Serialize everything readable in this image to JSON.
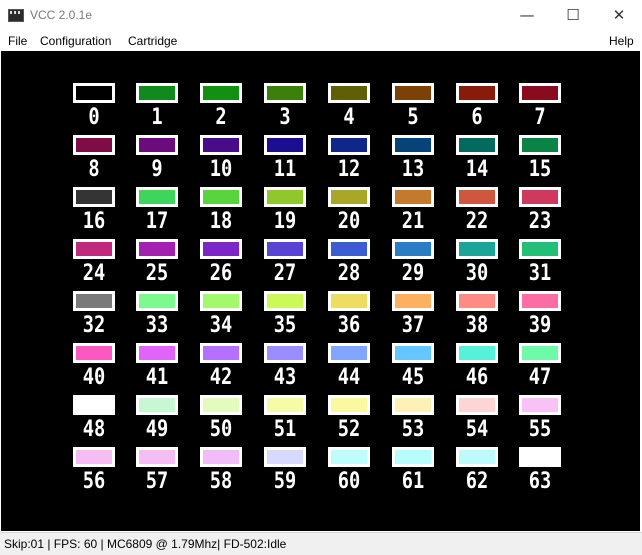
{
  "window": {
    "title": "VCC 2.0.1e",
    "minimize_glyph": "—",
    "maximize_glyph": "☐",
    "close_glyph": "✕"
  },
  "menu": {
    "file": "File",
    "configuration": "Configuration",
    "cartridge": "Cartridge",
    "help": "Help"
  },
  "palette": {
    "colors": [
      "#000000",
      "#12891c",
      "#139012",
      "#3c7f0a",
      "#5f6005",
      "#7d4006",
      "#891b0a",
      "#880b1e",
      "#7e0c45",
      "#6b0c7c",
      "#490c88",
      "#1b0e90",
      "#0d2889",
      "#074377",
      "#06695f",
      "#0a8344",
      "#343434",
      "#3fd45c",
      "#58d53d",
      "#8ec82c",
      "#aaa628",
      "#c47a2c",
      "#d0573f",
      "#d0395e",
      "#c0297c",
      "#a420b0",
      "#7c26c8",
      "#5744d4",
      "#3a5dd4",
      "#2a7cc4",
      "#1aa598",
      "#22c077",
      "#7a7a7a",
      "#7dfa8d",
      "#a3f86b",
      "#cbf957",
      "#eedd60",
      "#fdb060",
      "#fe8c84",
      "#fd6ca2",
      "#fd57c4",
      "#df64f7",
      "#b66ffe",
      "#9c8dfe",
      "#81a6fd",
      "#66c7fe",
      "#56f1d9",
      "#6efba8",
      "#ffffff",
      "#c7f8d3",
      "#e3fbbc",
      "#f6fba6",
      "#fcf8a2",
      "#fdf1b6",
      "#fdd5d2",
      "#f8c2f6",
      "#f6bcf3",
      "#f6bdf5",
      "#f2bcf9",
      "#d8d9fe",
      "#bdfdfd",
      "#b8fcfd",
      "#bcfbfd",
      "#ffffff"
    ]
  },
  "status": {
    "text": "Skip:01 | FPS: 60 | MC6809 @ 1.79Mhz| FD-502:Idle"
  }
}
